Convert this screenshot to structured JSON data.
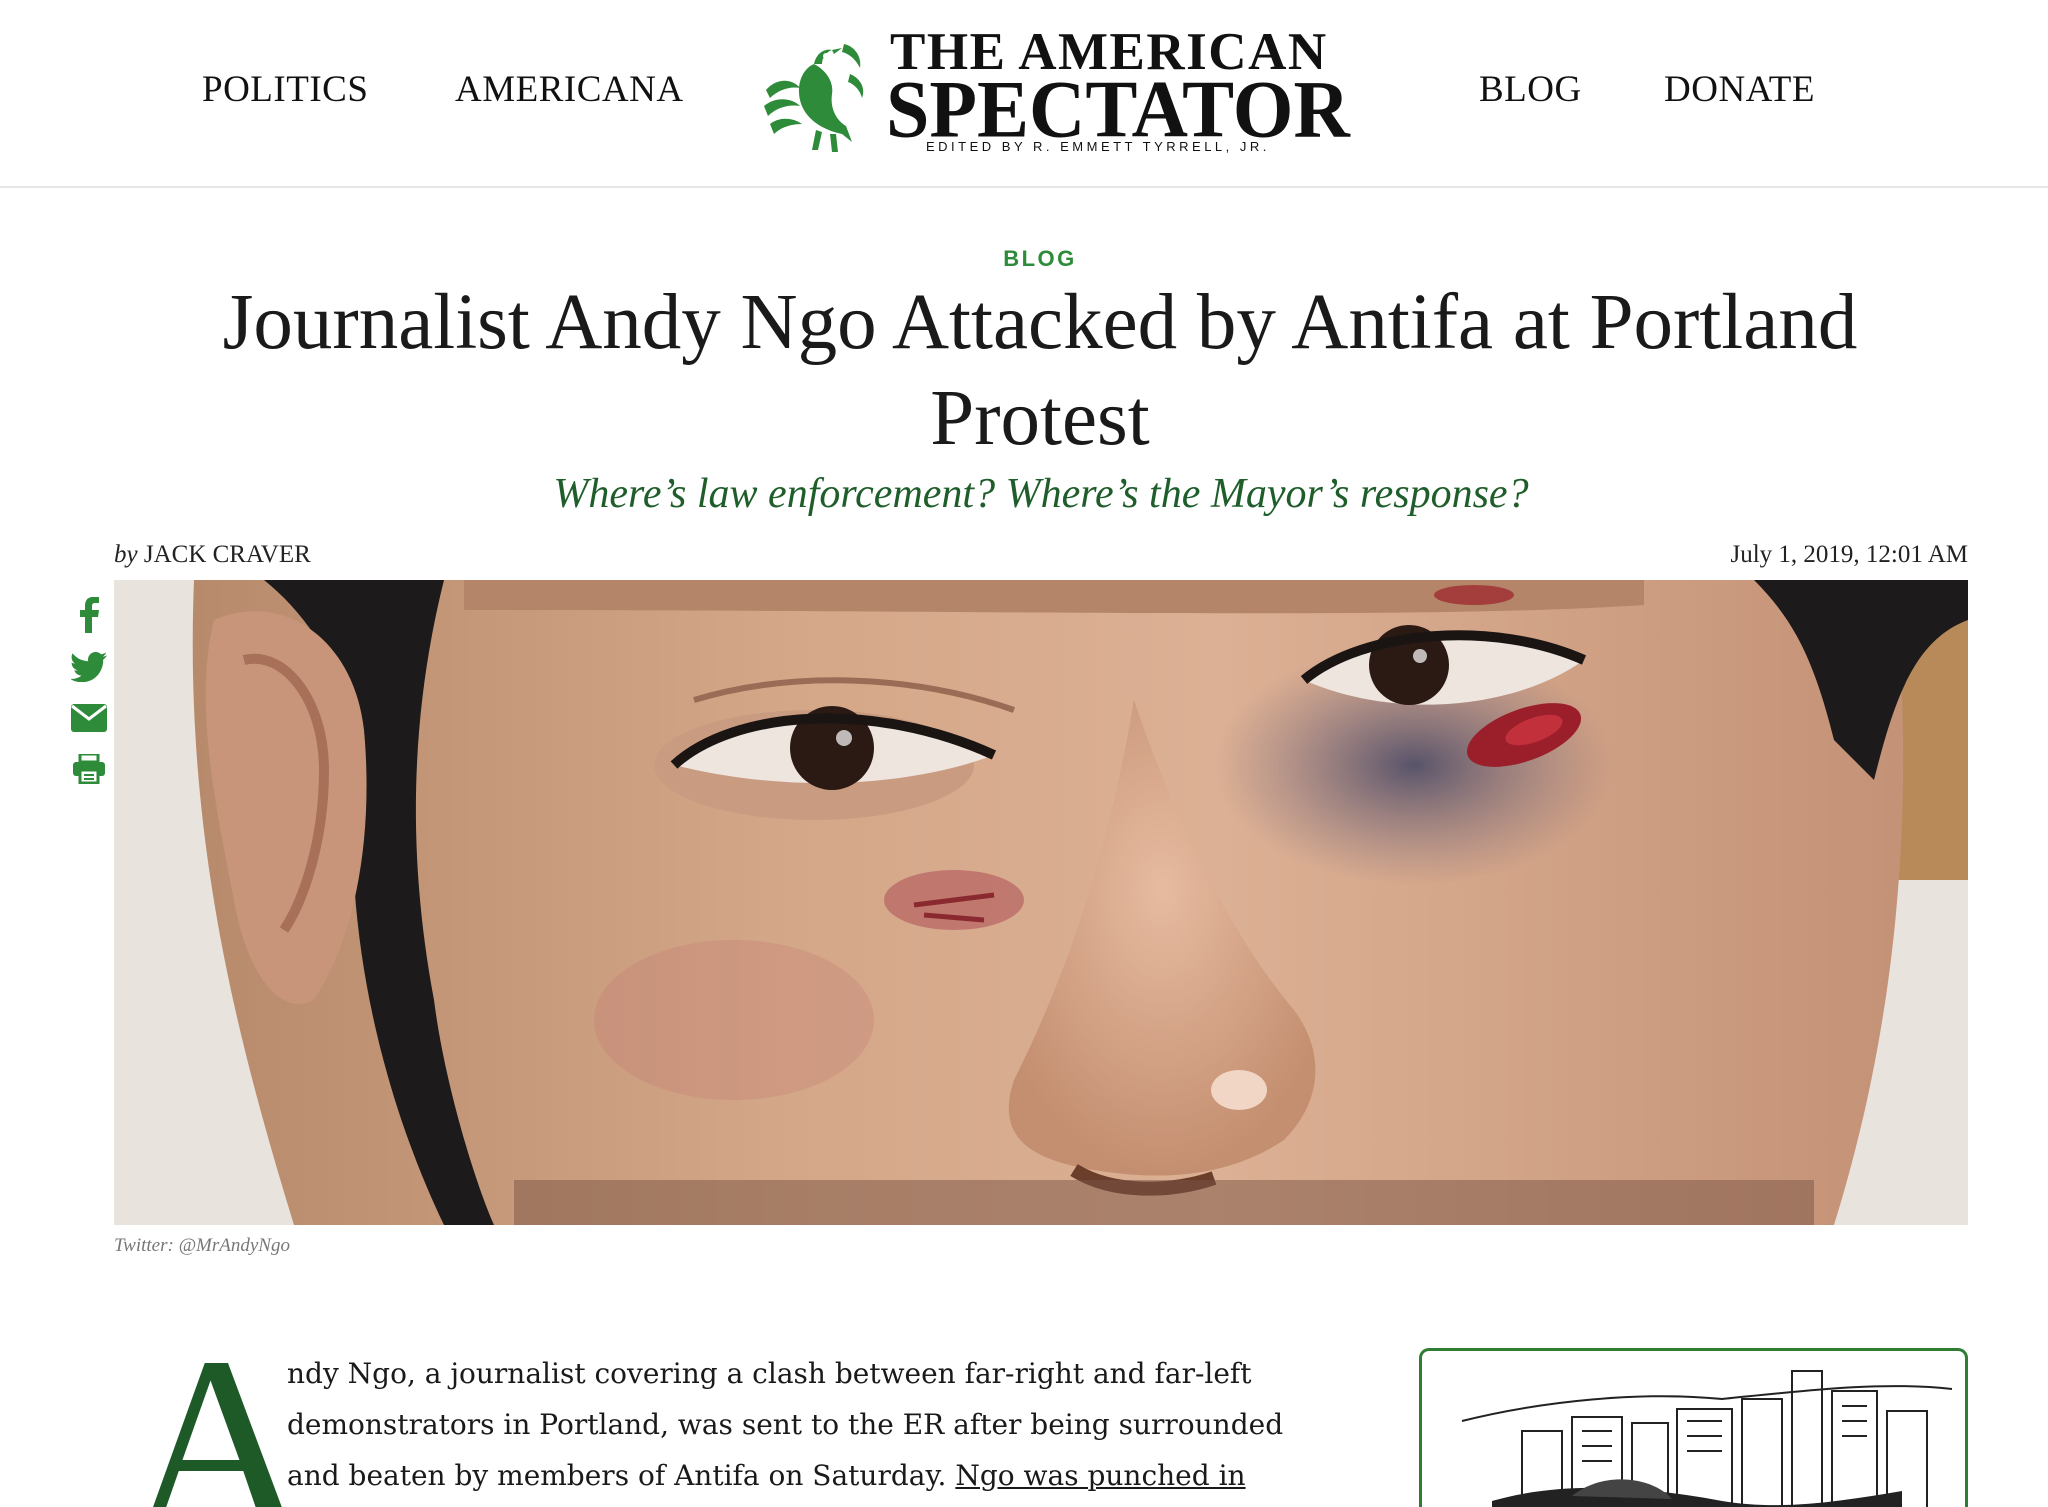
{
  "header": {
    "nav_left": [
      "POLITICS",
      "AMERICANA"
    ],
    "nav_right": [
      "BLOG",
      "DONATE"
    ],
    "logo": {
      "line1": "THE AMERICAN",
      "line2": "SPECTATOR",
      "edited_by": "EDITED BY R. EMMETT TYRRELL, JR."
    }
  },
  "article": {
    "category": "BLOG",
    "headline": "Journalist Andy Ngo Attacked by Antifa at Portland Protest",
    "subhead": "Where’s law enforcement? Where’s the Mayor’s response?",
    "byline_prefix": "by",
    "author": "JACK CRAVER",
    "date": "July 1, 2019, 12:01 AM",
    "photo_caption": "Twitter: @MrAndyNgo",
    "dropcap": "A",
    "body_start": "ndy Ngo, a journalist covering a clash between far-right and far-left demonstrators in Portland, was sent to the ER after being surrounded and beaten by members of Antifa on Saturday.",
    "body_link": "Ngo was punched in the head",
    "body_after_link": ","
  },
  "share_icons": [
    "facebook-icon",
    "twitter-icon",
    "email-icon",
    "print-icon"
  ],
  "colors": {
    "brand_green": "#2e8b3a",
    "subhead_green": "#1f5e2b",
    "dropcap_green": "#1e5a28"
  }
}
